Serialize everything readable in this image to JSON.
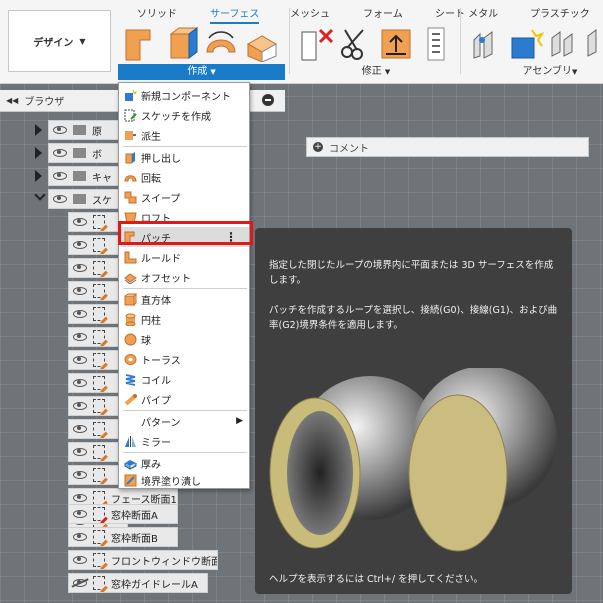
{
  "ribbon": {
    "design_label": "デザイン",
    "tabs": [
      "ソリッド",
      "サーフェス",
      "メッシュ",
      "フォーム",
      "シート メタル",
      "プラスチック"
    ],
    "active_tab": "サーフェス",
    "groups": {
      "create": "作成",
      "modify": "修正",
      "assembly": "アセンブリ"
    },
    "colors": {
      "accent": "#1a7cc9",
      "surface_icon": "#f0a050"
    }
  },
  "browser": {
    "title": "ブラウザ",
    "folders": [
      "原",
      "ボ",
      "キャ",
      "スケ"
    ],
    "sketch_items": [
      "",
      "",
      "",
      "",
      "",
      "",
      "",
      "",
      "",
      "",
      "",
      "",
      "",
      "",
      "フェース断面1",
      "窓枠断面A",
      "窓枠断面B",
      "フロントウィンドウ断面",
      "窓枠ガイドレールA"
    ]
  },
  "comment": {
    "label": "コメント"
  },
  "menu": {
    "items": [
      {
        "label": "新規コンポーネント",
        "icon": "new-component-icon"
      },
      {
        "label": "スケッチを作成",
        "icon": "create-sketch-icon"
      },
      {
        "label": "派生",
        "icon": "derive-icon"
      },
      {
        "label": "押し出し",
        "icon": "extrude-icon"
      },
      {
        "label": "回転",
        "icon": "revolve-icon"
      },
      {
        "label": "スイープ",
        "icon": "sweep-icon"
      },
      {
        "label": "ロフト",
        "icon": "loft-icon"
      },
      {
        "label": "パッチ",
        "icon": "patch-icon"
      },
      {
        "label": "ルールド",
        "icon": "ruled-icon"
      },
      {
        "label": "オフセット",
        "icon": "offset-icon"
      },
      {
        "label": "直方体",
        "icon": "box-icon"
      },
      {
        "label": "円柱",
        "icon": "cylinder-icon"
      },
      {
        "label": "球",
        "icon": "sphere-icon"
      },
      {
        "label": "トーラス",
        "icon": "torus-icon"
      },
      {
        "label": "コイル",
        "icon": "coil-icon"
      },
      {
        "label": "パイプ",
        "icon": "pipe-icon"
      },
      {
        "label": "パターン",
        "icon": ""
      },
      {
        "label": "ミラー",
        "icon": "mirror-icon"
      },
      {
        "label": "厚み",
        "icon": "thicken-icon"
      },
      {
        "label": "境界塗り潰し",
        "icon": "boundary-fill-icon"
      }
    ],
    "hovered": "パッチ"
  },
  "tooltip": {
    "p1": "指定した閉じたループの境界内に平面または 3D サーフェスを作成します。",
    "p2": "パッチを作成するループを選択し、接続(G0)、接線(G1)、および曲率(G2)境界条件を適用します。",
    "help": "ヘルプを表示するには Ctrl+/ を押してください。"
  }
}
